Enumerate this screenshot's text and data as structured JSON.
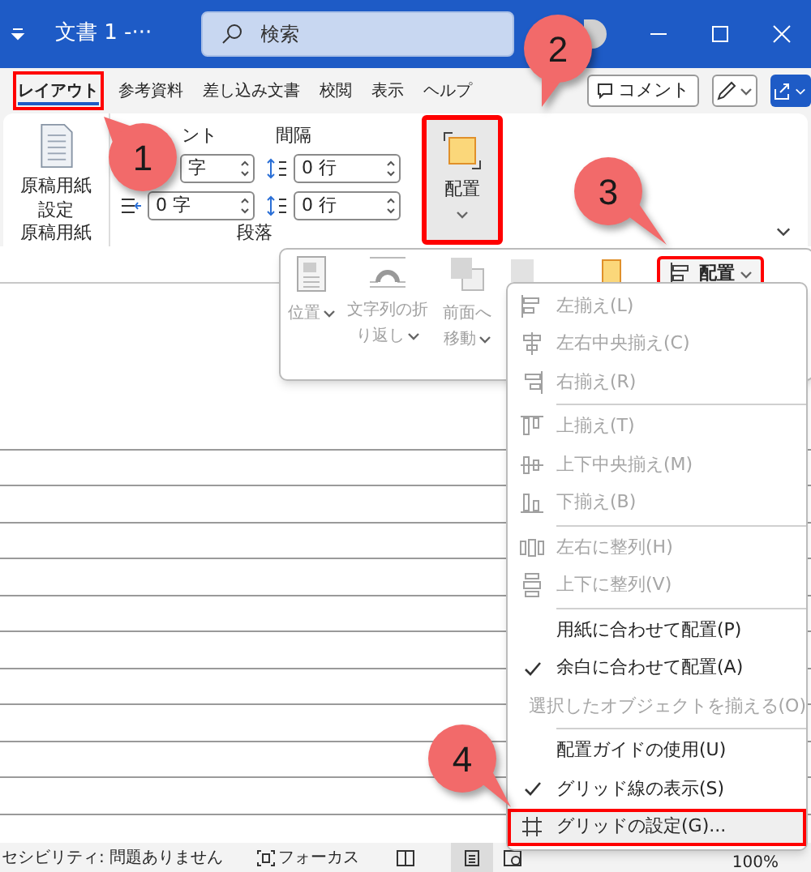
{
  "title_bar": {
    "title": "文書 1 -···",
    "search": {
      "placeholder": "検索"
    }
  },
  "tabs": [
    {
      "label": "レイアウト",
      "selected": true,
      "annotated": true
    },
    {
      "label": "参考資料",
      "selected": false,
      "annotated": false
    },
    {
      "label": "差し込み文書",
      "selected": false,
      "annotated": false
    },
    {
      "label": "校閲",
      "selected": false,
      "annotated": false
    },
    {
      "label": "表示",
      "selected": false,
      "annotated": false
    },
    {
      "label": "ヘルプ",
      "selected": false,
      "annotated": false
    }
  ],
  "comment_button": "コメント",
  "ribbon": {
    "manuscript": {
      "button": "原稿用紙設定",
      "group_label": "原稿用紙"
    },
    "paragraph": {
      "indent_heading": "ント",
      "spacing_heading": "間隔",
      "indent_fields": [
        "字",
        "0 字"
      ],
      "spacing_fields": [
        "0 行",
        "0 行"
      ],
      "group_label": "段落"
    },
    "arrange_button": {
      "label": "配置",
      "annotated": true,
      "selected": true
    }
  },
  "arrange_panel": {
    "buttons": [
      {
        "label": "位置"
      },
      {
        "label": "文字列の折り返し"
      },
      {
        "label": "前面へ移動"
      }
    ],
    "dropdown": {
      "label": "配置",
      "annotated": true
    }
  },
  "menu": {
    "items": [
      {
        "kind": "item",
        "label": "左揃え(L)",
        "disabled": true,
        "checked": false,
        "highlighted": false
      },
      {
        "kind": "item",
        "label": "左右中央揃え(C)",
        "disabled": true,
        "checked": false,
        "highlighted": false
      },
      {
        "kind": "item",
        "label": "右揃え(R)",
        "disabled": true,
        "checked": false,
        "highlighted": false
      },
      {
        "kind": "separator"
      },
      {
        "kind": "item",
        "label": "上揃え(T)",
        "disabled": true,
        "checked": false,
        "highlighted": false
      },
      {
        "kind": "item",
        "label": "上下中央揃え(M)",
        "disabled": true,
        "checked": false,
        "highlighted": false
      },
      {
        "kind": "item",
        "label": "下揃え(B)",
        "disabled": true,
        "checked": false,
        "highlighted": false
      },
      {
        "kind": "separator"
      },
      {
        "kind": "item",
        "label": "左右に整列(H)",
        "disabled": true,
        "checked": false,
        "highlighted": false
      },
      {
        "kind": "item",
        "label": "上下に整列(V)",
        "disabled": true,
        "checked": false,
        "highlighted": false
      },
      {
        "kind": "separator"
      },
      {
        "kind": "item",
        "label": "用紙に合わせて配置(P)",
        "disabled": false,
        "checked": false,
        "highlighted": false
      },
      {
        "kind": "item",
        "label": "余白に合わせて配置(A)",
        "disabled": false,
        "checked": true,
        "highlighted": false
      },
      {
        "kind": "item",
        "label": "選択したオブジェクトを揃える(O)",
        "disabled": true,
        "checked": false,
        "highlighted": false
      },
      {
        "kind": "separator"
      },
      {
        "kind": "item",
        "label": "配置ガイドの使用(U)",
        "disabled": false,
        "checked": false,
        "highlighted": false
      },
      {
        "kind": "item",
        "label": "グリッド線の表示(S)",
        "disabled": false,
        "checked": true,
        "highlighted": false
      },
      {
        "kind": "item",
        "label": "グリッドの設定(G)...",
        "disabled": false,
        "checked": false,
        "highlighted": true
      }
    ]
  },
  "status_bar": {
    "accessibility": "セシビリティ: 問題ありません",
    "focus": "フォーカス",
    "zoom": "100%"
  },
  "callouts": [
    {
      "number": "1"
    },
    {
      "number": "2"
    },
    {
      "number": "3"
    },
    {
      "number": "4"
    }
  ]
}
